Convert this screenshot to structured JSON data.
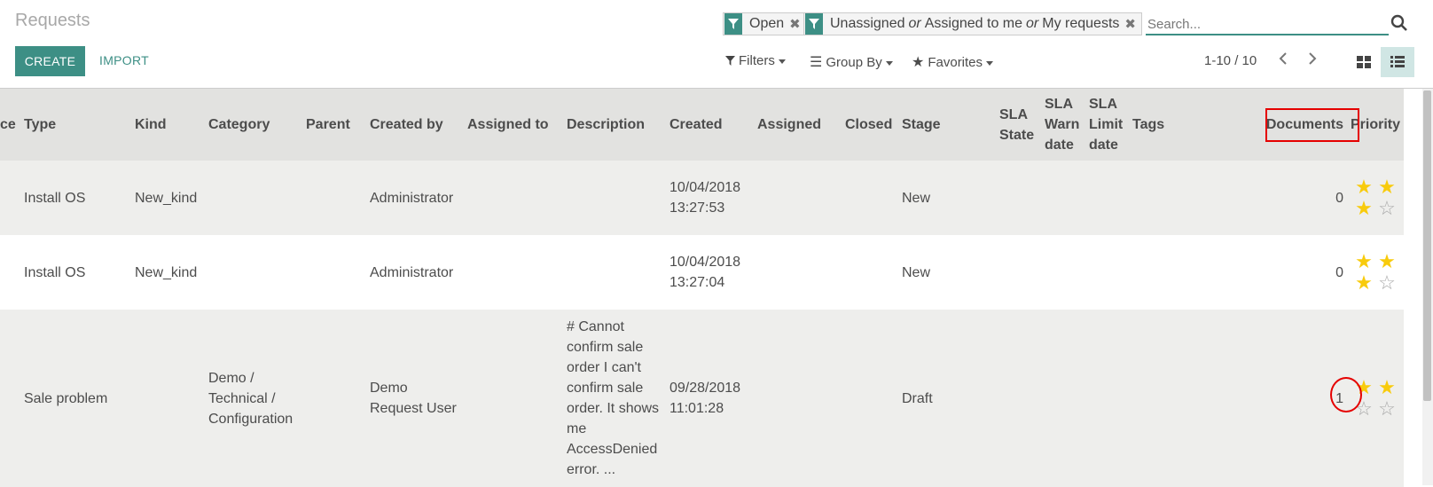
{
  "header": {
    "title": "Requests",
    "create_label": "CREATE",
    "import_label": "IMPORT"
  },
  "search": {
    "facets": [
      {
        "values": [
          "Open"
        ]
      },
      {
        "values": [
          "Unassigned",
          "Assigned to me",
          "My requests"
        ],
        "separator": "or"
      }
    ],
    "placeholder": "Search..."
  },
  "controls": {
    "filters": "Filters",
    "group_by": "Group By",
    "favorites": "Favorites",
    "pager": "1-10 / 10"
  },
  "table": {
    "columns": {
      "ref_partial": "ce",
      "type": "Type",
      "kind": "Kind",
      "category": "Category",
      "parent": "Parent",
      "created_by": "Created by",
      "assigned_to": "Assigned to",
      "description": "Description",
      "created": "Created",
      "assigned": "Assigned",
      "closed": "Closed",
      "stage": "Stage",
      "sla_state": "SLA State",
      "sla_warn_date": "SLA Warn date",
      "sla_limit_date": "SLA Limit date",
      "tags": "Tags",
      "documents": "Documents",
      "priority": "Priority"
    },
    "rows": [
      {
        "type": "Install OS",
        "kind": "New_kind",
        "category": "",
        "created_by": "Administrator",
        "description": "",
        "created": "10/04/2018 13:27:53",
        "stage": "New",
        "documents": "0",
        "priority_stars": 3
      },
      {
        "type": "Install OS",
        "kind": "New_kind",
        "category": "",
        "created_by": "Administrator",
        "description": "",
        "created": "10/04/2018 13:27:04",
        "stage": "New",
        "documents": "0",
        "priority_stars": 3
      },
      {
        "type": "Sale problem",
        "kind": "",
        "category": "Demo / Technical / Configuration",
        "created_by": "Demo Request User",
        "description": "# Cannot confirm sale order I can't confirm sale order. It shows me AccessDenied error. ...",
        "created": "09/28/2018 11:01:28",
        "stage": "Draft",
        "documents": "1",
        "priority_stars": 2
      }
    ]
  },
  "colors": {
    "accent": "#3d8f85",
    "star": "#f8cb0c",
    "highlight": "#e50000"
  }
}
